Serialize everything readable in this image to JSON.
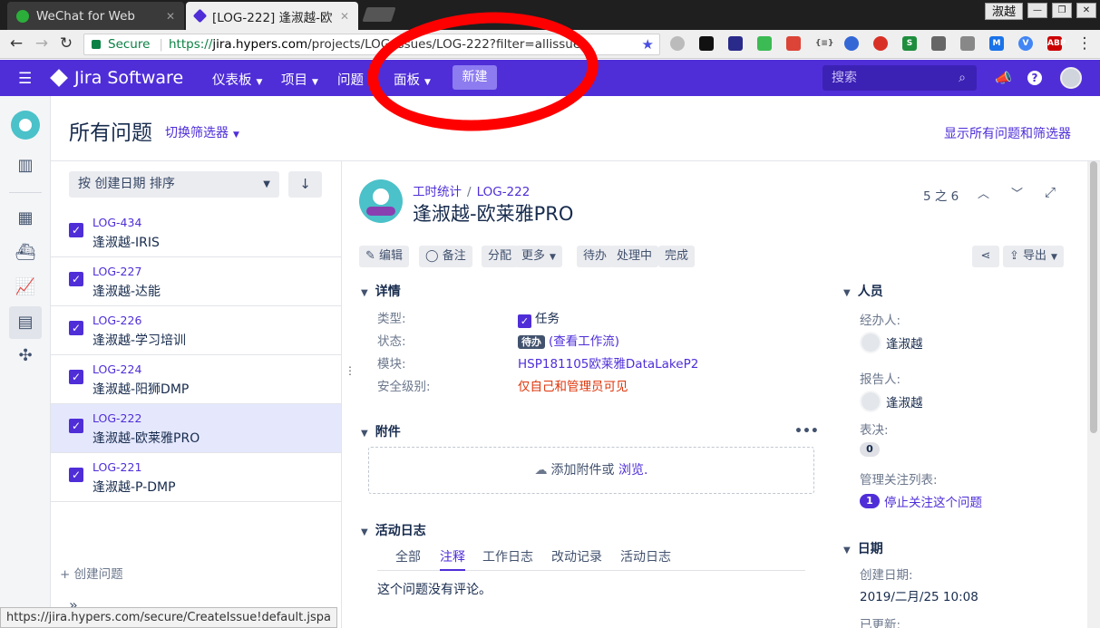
{
  "browser": {
    "tabs": [
      {
        "title": "WeChat for Web",
        "close": "✕"
      },
      {
        "title": "[LOG-222] 逢淑越-欧",
        "close": "✕"
      }
    ],
    "window_user": "淑越",
    "secure_label": "Secure",
    "url_scheme": "https://",
    "url_host": "jira.hypers.com",
    "url_path": "/projects/LOG/issues/LOG-222?filter=allissues",
    "status_url": "https://jira.hypers.com/secure/CreateIssue!default.jspa"
  },
  "topnav": {
    "product": "Jira Software",
    "items": [
      "仪表板",
      "项目",
      "问题",
      "面板"
    ],
    "create": "新建",
    "search_placeholder": "搜索"
  },
  "page": {
    "title": "所有问题",
    "switch_filter": "切换筛选器",
    "show_all": "显示所有问题和筛选器"
  },
  "list": {
    "sort": "按 创建日期 排序",
    "issues": [
      {
        "key": "LOG-434",
        "summary": "逢淑越-IRIS"
      },
      {
        "key": "LOG-227",
        "summary": "逢淑越-达能"
      },
      {
        "key": "LOG-226",
        "summary": "逢淑越-学习培训"
      },
      {
        "key": "LOG-224",
        "summary": "逢淑越-阳狮DMP"
      },
      {
        "key": "LOG-222",
        "summary": "逢淑越-欧莱雅PRO"
      },
      {
        "key": "LOG-221",
        "summary": "逢淑越-P-DMP"
      }
    ],
    "create_issue": "+ 创建问题"
  },
  "detail": {
    "project": "工时统计",
    "key": "LOG-222",
    "title": "逢淑越-欧莱雅PRO",
    "pager": "5 之 6",
    "actions": [
      "编辑",
      "备注",
      "分配",
      "更多",
      "待办",
      "处理中",
      "完成"
    ],
    "share": "",
    "export": "导出",
    "details_header": "详情",
    "fields": [
      {
        "label": "类型:",
        "value": "任务"
      },
      {
        "label": "状态:",
        "value": "待办",
        "extra": "(查看工作流)"
      },
      {
        "label": "模块:",
        "value": "HSP181105欧莱雅DataLakeP2"
      },
      {
        "label": "安全级别:",
        "value": "仅自己和管理员可见"
      }
    ],
    "attachments_header": "附件",
    "attach_text": "添加附件或",
    "attach_link": "浏览.",
    "activity_header": "活动日志",
    "activity_tabs": [
      "全部",
      "注释",
      "工作日志",
      "改动记录",
      "活动日志"
    ],
    "no_comments": "这个问题没有评论。"
  },
  "people": {
    "header": "人员",
    "assignee_label": "经办人:",
    "assignee": "逢淑越",
    "reporter_label": "报告人:",
    "reporter": "逢淑越",
    "votes_label": "表决:",
    "votes": "0",
    "watchers_label": "管理关注列表:",
    "watchers_count": "1",
    "watch_link": "停止关注这个问题"
  },
  "dates": {
    "header": "日期",
    "created_label": "创建日期:",
    "created": "2019/二月/25 10:08",
    "updated_label": "已更新:"
  },
  "colors": {
    "brand": "#4f2ed8",
    "annotation": "#ff0000"
  }
}
